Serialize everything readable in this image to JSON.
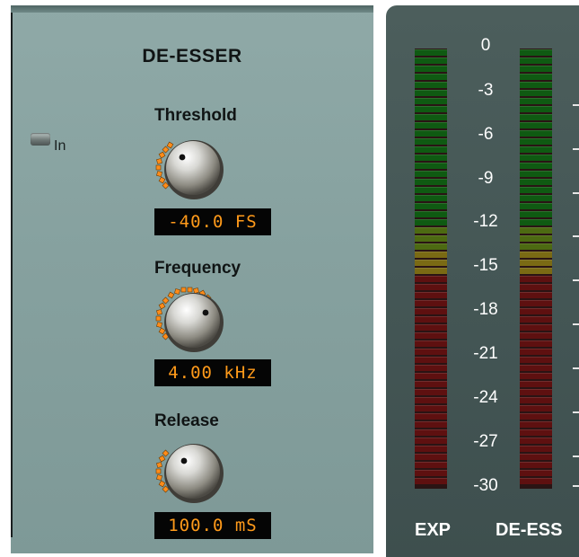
{
  "plugin": {
    "title": "DE-ESSER",
    "in_label": "In",
    "controls": [
      {
        "label": "Threshold",
        "value": "-40.0 FS"
      },
      {
        "label": "Frequency",
        "value": "4.00 kHz"
      },
      {
        "label": "Release",
        "value": "100.0 mS"
      }
    ]
  },
  "meters": {
    "scale": [
      "0",
      "-3",
      "-6",
      "-9",
      "-12",
      "-15",
      "-18",
      "-21",
      "-24",
      "-27",
      "-30"
    ],
    "labels": [
      "EXP",
      "DE-ESS"
    ]
  },
  "colors": {
    "panel": "#86a19f",
    "readout_bg": "#050505",
    "readout_text": "#ff9a1a",
    "led_green": "#0f5a12",
    "led_yellow": "#7a6a14",
    "led_red": "#5e1010",
    "meter_panel": "#455756"
  }
}
